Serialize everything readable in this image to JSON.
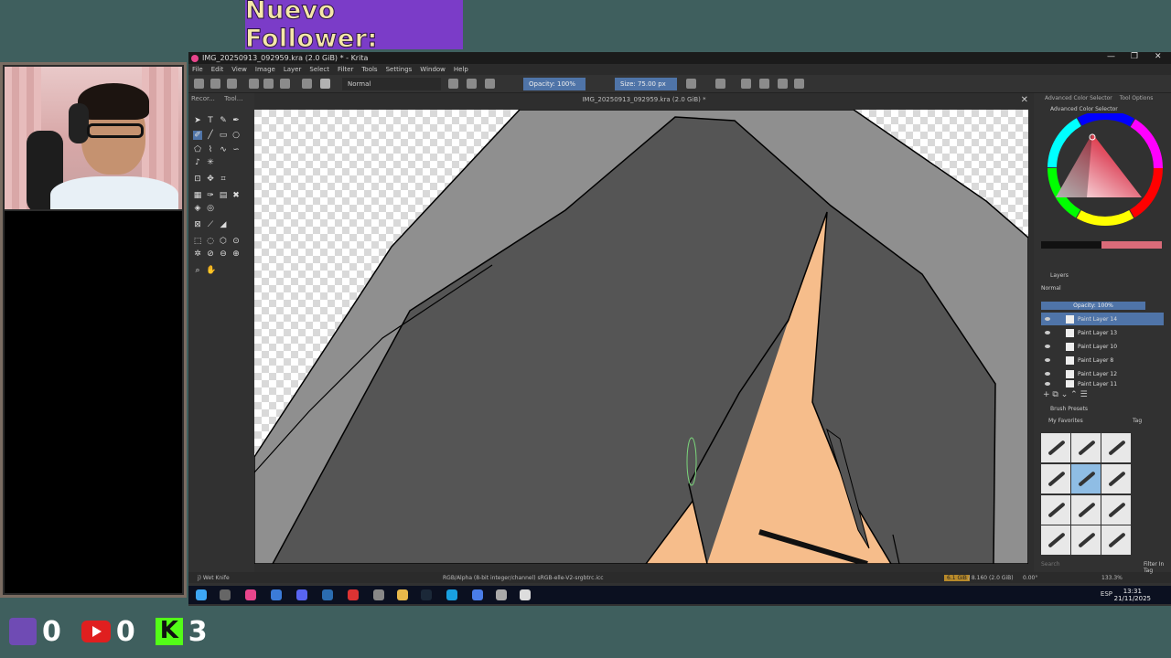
{
  "overlay": {
    "banner_text": "Nuevo Follower:",
    "stats": [
      {
        "platform": "twitch-icon",
        "value": "0"
      },
      {
        "platform": "youtube-icon",
        "value": "0"
      },
      {
        "platform": "kick-icon",
        "value": "3"
      }
    ]
  },
  "window": {
    "title": "IMG_20250913_092959.kra (2.0 GiB) * - Krita",
    "controls": [
      "—",
      "❐",
      "✕"
    ]
  },
  "menu": [
    "File",
    "Edit",
    "View",
    "Image",
    "Layer",
    "Select",
    "Filter",
    "Tools",
    "Settings",
    "Window",
    "Help"
  ],
  "toolbar": {
    "blend_mode": "Normal",
    "opacity": "Opacity: 100%",
    "size": "Size: 75.00 px"
  },
  "left_tabs": [
    "Recor...",
    "Tool..."
  ],
  "document": {
    "tab_title": "IMG_20250913_092959.kra (2.0 GiB) *"
  },
  "status": {
    "brush": "j) Wet Knife",
    "color_info": "RGB/Alpha (8-bit integer/channel)  sRGB-elle-V2-srgbtrc.icc",
    "memory": "6.1 GiB",
    "memory_total": "/ 8.160 (2.0 GiB)",
    "angle": "0.00°",
    "zoom": "133.3%"
  },
  "dock": {
    "tabs": [
      "Advanced Color Selector",
      "Tool Options"
    ],
    "color_selector_title": "Advanced Color Selector",
    "layers_title": "Layers",
    "layers_blend": "Normal",
    "layers_opacity": "Opacity: 100%",
    "layers": [
      "Paint Layer 14",
      "Paint Layer 13",
      "Paint Layer 10",
      "Paint Layer 8",
      "Paint Layer 12",
      "Paint Layer 11"
    ],
    "brush_presets_title": "Brush Presets",
    "brush_tag": "My Favorites",
    "tag_label": "Tag",
    "search_placeholder": "Search",
    "filter_label": "Filter In Tag"
  },
  "taskbar": {
    "tray": "ESP",
    "time": "13:31",
    "date": "21/11/2025"
  }
}
